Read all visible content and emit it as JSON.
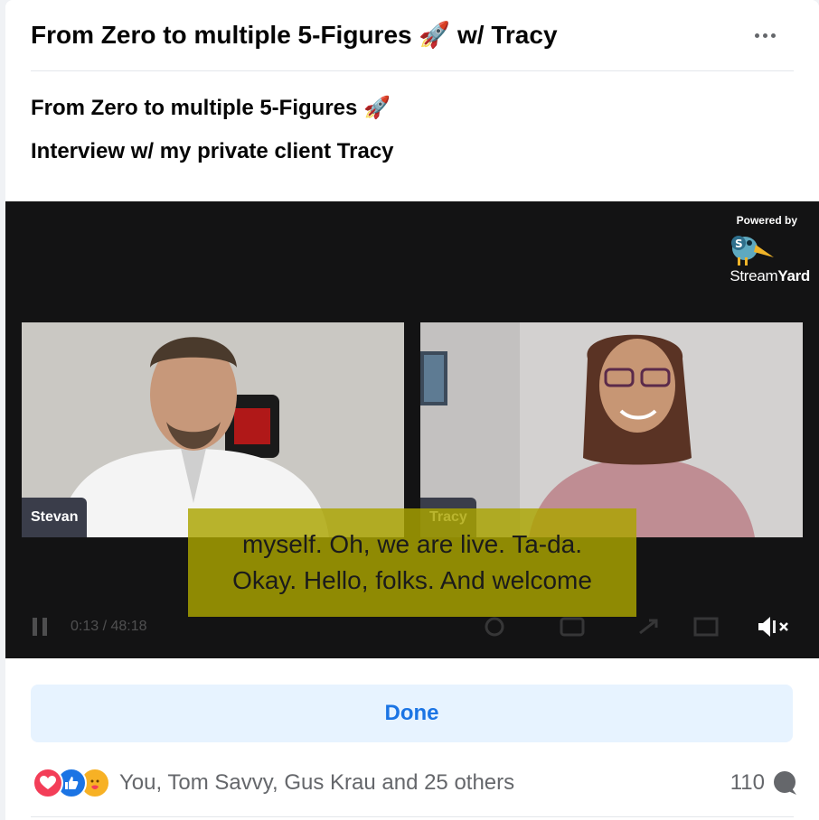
{
  "post": {
    "title": "From Zero to multiple 5-Figures 🚀 w/ Tracy",
    "description_line1": "From Zero to multiple 5-Figures 🚀",
    "description_line2": "Interview w/ my private client Tracy"
  },
  "video": {
    "powered_by": "Powered by",
    "brand_stream": "Stream",
    "brand_yard": "Yard",
    "participants": [
      {
        "name": "Stevan"
      },
      {
        "name": "Tracy"
      }
    ],
    "caption_line1": "myself. Oh, we are live. Ta-da.",
    "caption_line2": "Okay. Hello, folks. And welcome",
    "timecode": "0:13 / 48:18",
    "muted": true
  },
  "actions": {
    "done_label": "Done"
  },
  "reactions": {
    "types": [
      "love-icon",
      "like-icon",
      "care-icon"
    ],
    "summary": "You, Tom Savvy, Gus Krau and 25 others",
    "comment_count": "110"
  },
  "colors": {
    "accent": "#1b74e4",
    "button_bg": "#e7f3ff",
    "caption_bg": "#aba500",
    "video_bg": "#131314"
  }
}
